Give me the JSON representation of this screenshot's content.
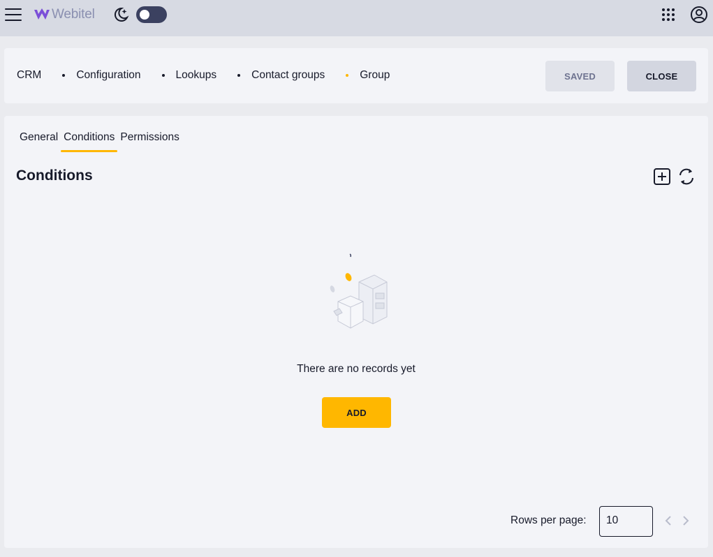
{
  "appbar": {
    "logo_text": "Webitel",
    "icons": [
      "menu-icon",
      "webitel-logo-icon",
      "night-mode-icon",
      "apps-grid-icon",
      "account-icon"
    ],
    "theme_toggle": "off"
  },
  "breadcrumb": {
    "items": [
      "CRM",
      "Configuration",
      "Lookups",
      "Contact groups",
      "Group"
    ]
  },
  "header_actions": {
    "saved_label": "SAVED",
    "close_label": "CLOSE"
  },
  "tabs": {
    "items": [
      "General",
      "Conditions",
      "Permissions"
    ],
    "active": "Conditions"
  },
  "section": {
    "title": "Conditions",
    "icons": [
      "add-icon",
      "refresh-icon"
    ]
  },
  "empty_state": {
    "text": "There are no records yet",
    "add_label": "ADD"
  },
  "pagination": {
    "rows_label": "Rows per page:",
    "rows_value": "10"
  },
  "colors": {
    "accent": "#ffb700",
    "appbar": "#d7dae3",
    "card": "#f3f4f8",
    "text": "#171a2a"
  }
}
